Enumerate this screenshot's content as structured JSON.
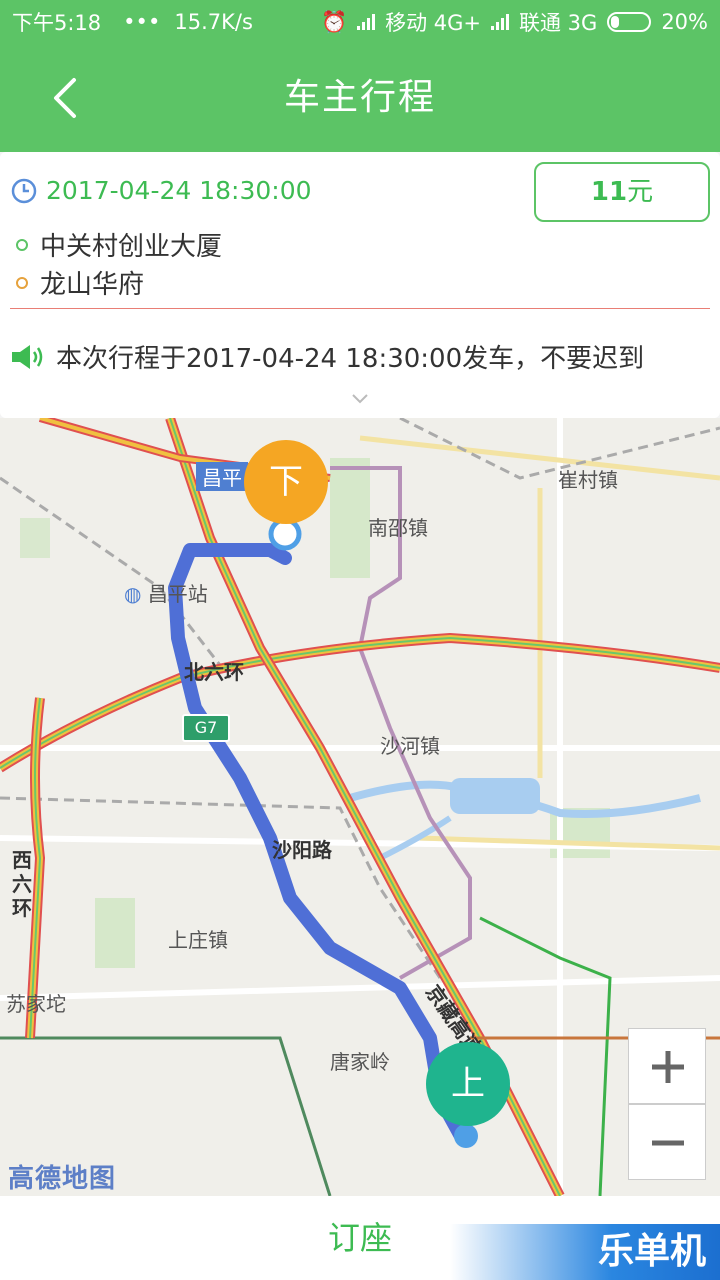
{
  "status_bar": {
    "time": "下午5:18",
    "dots": "•••",
    "speed": "15.7K/s",
    "carrier1": "移动 4G+",
    "carrier2": "联通 3G",
    "battery": "20%"
  },
  "header": {
    "back_icon": "chevron-left-icon",
    "title": "车主行程"
  },
  "trip": {
    "time_icon": "clock-icon",
    "departure_time": "2017-04-24 18:30:00",
    "price_value": "11",
    "price_unit": "元",
    "origin": "中关村创业大厦",
    "destination": "龙山华府",
    "origin_dot_color": "#5cc466",
    "destination_dot_color": "#e6a23c",
    "notice_icon": "speaker-icon",
    "notice": "本次行程于2017-04-24 18:30:00发车，不要迟到",
    "expand_icon": "chevron-down-icon"
  },
  "map": {
    "labels": {
      "changping_station": "昌平站",
      "changping_tag": "昌平",
      "nanshao": "南邵镇",
      "cuicun": "崔村镇",
      "north_6th_ring": "北六环",
      "g7": "G7",
      "shahe": "沙河镇",
      "shayang_road": "沙阳路",
      "west_6th_ring": "西六环",
      "shangzhuang": "上庄镇",
      "sujiatuo": "苏家坨",
      "tangjialing": "唐家岭",
      "jingzang": "京藏高速"
    },
    "pin_drop": "下",
    "pin_pickup": "上",
    "pin_drop_color": "#f5a623",
    "pin_pickup_color": "#1fb48e",
    "zoom_in_label": "+",
    "zoom_out_label": "−",
    "provider": "高德地图",
    "route_color": "#4f6fd6"
  },
  "bottom": {
    "book_label": "订座",
    "watermark": "乐单机"
  }
}
